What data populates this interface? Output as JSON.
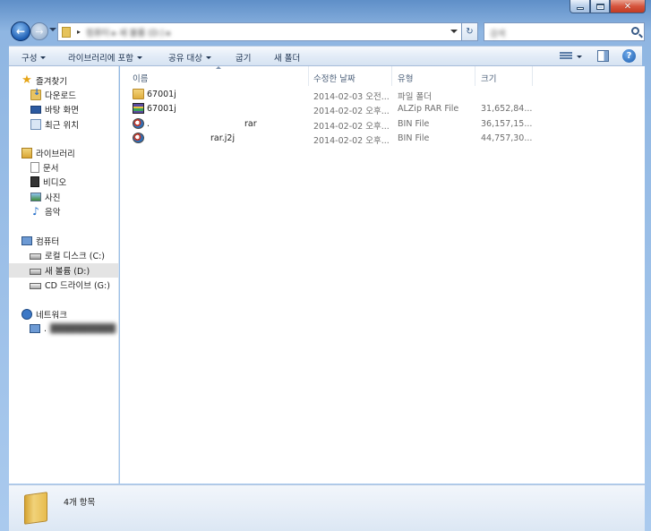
{
  "caption": {
    "minimize_icon": "minimize-icon",
    "maximize_icon": "maximize-icon",
    "close_icon": "close-icon"
  },
  "navbar": {
    "address_text": "컴퓨터 ▸ 새 볼륨 (D:) ▸",
    "search_placeholder": "검색"
  },
  "toolbar": {
    "organize": "구성",
    "include_in_library": "라이브러리에 포함",
    "share_with": "공유 대상",
    "burn": "굽기",
    "new_folder": "새 폴더"
  },
  "navpane": {
    "favorites": {
      "label": "즐겨찾기",
      "items": [
        {
          "label": "다운로드",
          "icon": "downloads-icon"
        },
        {
          "label": "바탕 화면",
          "icon": "desktop-icon"
        },
        {
          "label": "최근 위치",
          "icon": "recent-places-icon"
        }
      ]
    },
    "libraries": {
      "label": "라이브러리",
      "items": [
        {
          "label": "문서",
          "icon": "documents-icon"
        },
        {
          "label": "비디오",
          "icon": "videos-icon"
        },
        {
          "label": "사진",
          "icon": "pictures-icon"
        },
        {
          "label": "음악",
          "icon": "music-icon"
        }
      ]
    },
    "computer": {
      "label": "컴퓨터",
      "items": [
        {
          "label": "로컬 디스크 (C:)",
          "icon": "local-disk-icon"
        },
        {
          "label": "새 볼륨 (D:)",
          "icon": "volume-icon",
          "selected": true
        },
        {
          "label": "CD 드라이브 (G:)",
          "icon": "cd-drive-icon"
        }
      ]
    },
    "network": {
      "label": "네트워크",
      "items": [
        {
          "label": ".",
          "icon": "network-computer-icon"
        }
      ]
    }
  },
  "columns": {
    "name": "이름",
    "date_modified": "수정한 날짜",
    "type": "유형",
    "size": "크기"
  },
  "files": [
    {
      "name": "67001j",
      "date": "2014-02-03 오전...",
      "type": "파일 폴더",
      "size": "",
      "icon": "folder-icon"
    },
    {
      "name": "67001j",
      "date": "2014-02-02 오후...",
      "type": "ALZip RAR File",
      "size": "31,652,84...",
      "icon": "rar-archive-icon"
    },
    {
      "name": ".",
      "name_suffix": "rar",
      "date": "2014-02-02 오후...",
      "type": "BIN File",
      "size": "36,157,15...",
      "icon": "bin-file-icon"
    },
    {
      "name": "",
      "name_suffix": "rar.j2j",
      "date": "2014-02-02 오후...",
      "type": "BIN File",
      "size": "44,757,30...",
      "icon": "bin-file-icon"
    }
  ],
  "details": {
    "item_count": "4개 항목"
  }
}
